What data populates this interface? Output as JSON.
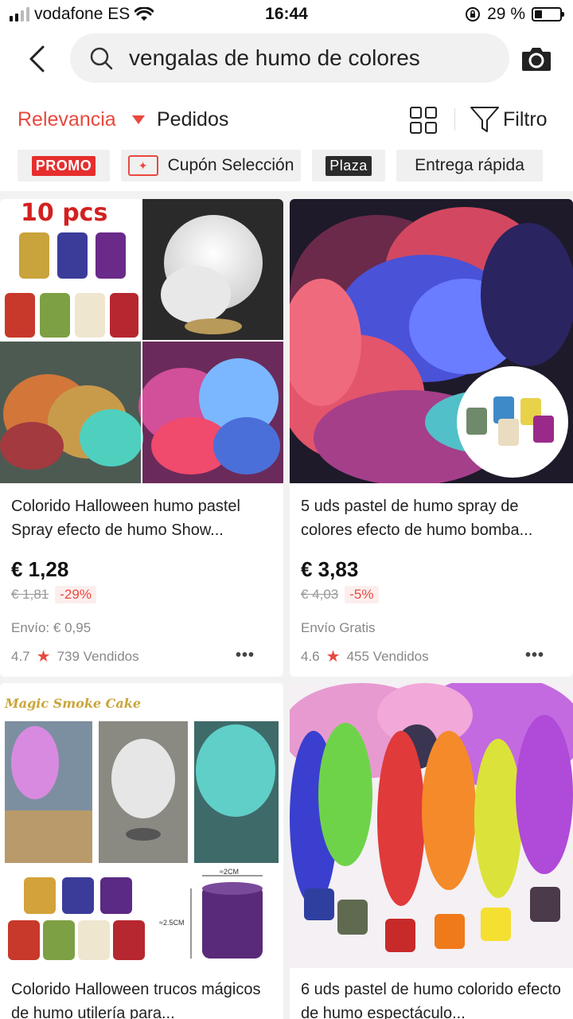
{
  "status": {
    "carrier": "vodafone ES",
    "time": "16:44",
    "battery": "29 %",
    "battery_level": 0.29
  },
  "search": {
    "query": "vengalas de humo de colores"
  },
  "sort": {
    "relevance": "Relevancia",
    "orders": "Pedidos",
    "filter": "Filtro"
  },
  "chips": {
    "promo": "PROMO",
    "coupon": "Cupón Selección",
    "plaza": "Plaza",
    "fast": "Entrega rápida"
  },
  "products": [
    {
      "title": "Colorido Halloween humo pastel Spray efecto de humo Show...",
      "price": "€ 1,28",
      "old_price": "€ 1,81",
      "discount": "-29%",
      "shipping": "Envío: € 0,95",
      "rating": "4.7",
      "sold": "739 Vendidos",
      "image_label": "10 pcs"
    },
    {
      "title": "5 uds pastel de humo spray de colores efecto de humo bomba...",
      "price": "€ 3,83",
      "old_price": "€ 4,03",
      "discount": "-5%",
      "shipping": "Envío Gratis",
      "rating": "4.6",
      "sold": "455 Vendidos"
    },
    {
      "title": "Colorido Halloween trucos mágicos de humo utilería para...",
      "image_label": "Magic Smoke Cake",
      "dim_w": "≈2CM",
      "dim_h": "≈2.5CM"
    },
    {
      "title": "6 uds pastel de humo colorido efecto de humo espectáculo..."
    }
  ],
  "more_label": "•••",
  "colors": {
    "accent": "#e8493f",
    "badge_red": "#e62e2e",
    "badge_dark": "#2b2b2b"
  }
}
